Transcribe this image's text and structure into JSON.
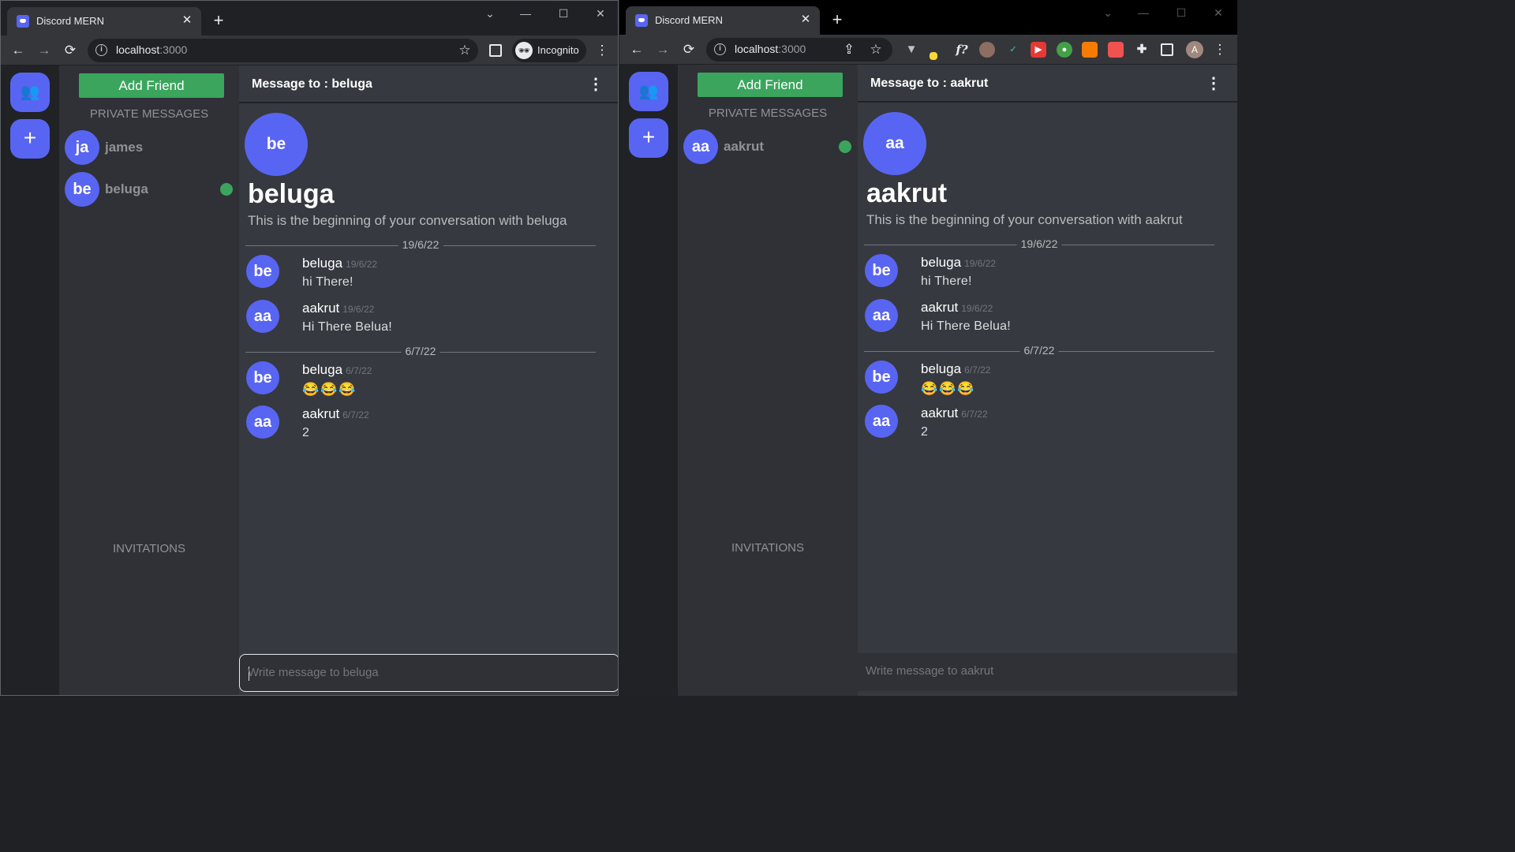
{
  "left_window": {
    "tab_title": "Discord MERN",
    "url_host": "localhost",
    "url_port": ":3000",
    "incognito_label": "Incognito",
    "add_friend_label": "Add Friend",
    "private_messages_title": "PRIVATE MESSAGES",
    "invitations_title": "INVITATIONS",
    "contacts": [
      {
        "initials": "ja",
        "name": "james",
        "online": false
      },
      {
        "initials": "be",
        "name": "beluga",
        "online": true
      }
    ],
    "chat": {
      "header_title": "Message to : beluga",
      "big_avatar_initials": "be",
      "big_name": "beluga",
      "begin_text": "This is the beginning of your conversation with beluga",
      "date_separators": [
        "19/6/22",
        "6/7/22"
      ],
      "messages": [
        {
          "initials": "be",
          "author": "beluga",
          "date": "19/6/22",
          "text": "hi There!"
        },
        {
          "initials": "aa",
          "author": "aakrut",
          "date": "19/6/22",
          "text": "Hi There Belua!"
        },
        {
          "initials": "be",
          "author": "beluga",
          "date": "6/7/22",
          "text": "😂😂😂"
        },
        {
          "initials": "aa",
          "author": "aakrut",
          "date": "6/7/22",
          "text": "2"
        }
      ],
      "composer_placeholder": "Write message to beluga"
    }
  },
  "right_window": {
    "tab_title": "Discord MERN",
    "url_host": "localhost",
    "url_port": ":3000",
    "profile_initial": "A",
    "add_friend_label": "Add Friend",
    "private_messages_title": "PRIVATE MESSAGES",
    "invitations_title": "INVITATIONS",
    "contacts": [
      {
        "initials": "aa",
        "name": "aakrut",
        "online": true
      }
    ],
    "chat": {
      "header_title": "Message to : aakrut",
      "big_avatar_initials": "aa",
      "big_name": "aakrut",
      "begin_text": "This is the beginning of your conversation with aakrut",
      "date_separators": [
        "19/6/22",
        "6/7/22"
      ],
      "messages": [
        {
          "initials": "be",
          "author": "beluga",
          "date": "19/6/22",
          "text": "hi There!"
        },
        {
          "initials": "aa",
          "author": "aakrut",
          "date": "19/6/22",
          "text": "Hi There Belua!"
        },
        {
          "initials": "be",
          "author": "beluga",
          "date": "6/7/22",
          "text": "😂😂😂"
        },
        {
          "initials": "aa",
          "author": "aakrut",
          "date": "6/7/22",
          "text": "2"
        }
      ],
      "composer_placeholder": "Write message to aakrut"
    }
  },
  "icons": {
    "friends": "👥",
    "add_server": "+",
    "back": "←",
    "forward": "→",
    "reload": "⟳",
    "star": "☆",
    "menu": "⋮",
    "close": "✕",
    "new_tab": "+",
    "minimize": "—",
    "maximize": "☐",
    "window_close": "✕",
    "collapse": "⌄",
    "info": "i"
  },
  "colors": {
    "brand": "#5865f2",
    "add_friend": "#3ba55d",
    "online": "#3ba55d",
    "chat_bg": "#36393f",
    "sidebar_bg": "#2f3136",
    "guild_bg": "#202225"
  }
}
